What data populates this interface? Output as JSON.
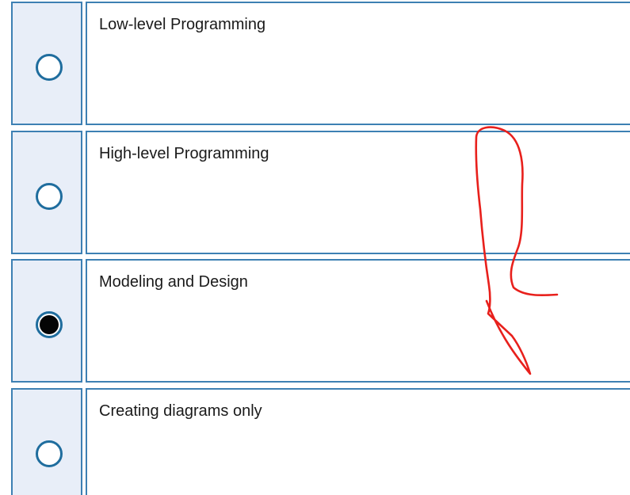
{
  "options": [
    {
      "label": "Low-level Programming",
      "selected": false
    },
    {
      "label": "High-level Programming",
      "selected": false
    },
    {
      "label": "Modeling and Design",
      "selected": true
    },
    {
      "label": "Creating diagrams only",
      "selected": false
    }
  ],
  "colors": {
    "cell_border": "#3d80b3",
    "radio_cell_background": "#e8eef8",
    "radio_border": "#1f6d9e",
    "annotation_stroke": "#e8201c"
  }
}
